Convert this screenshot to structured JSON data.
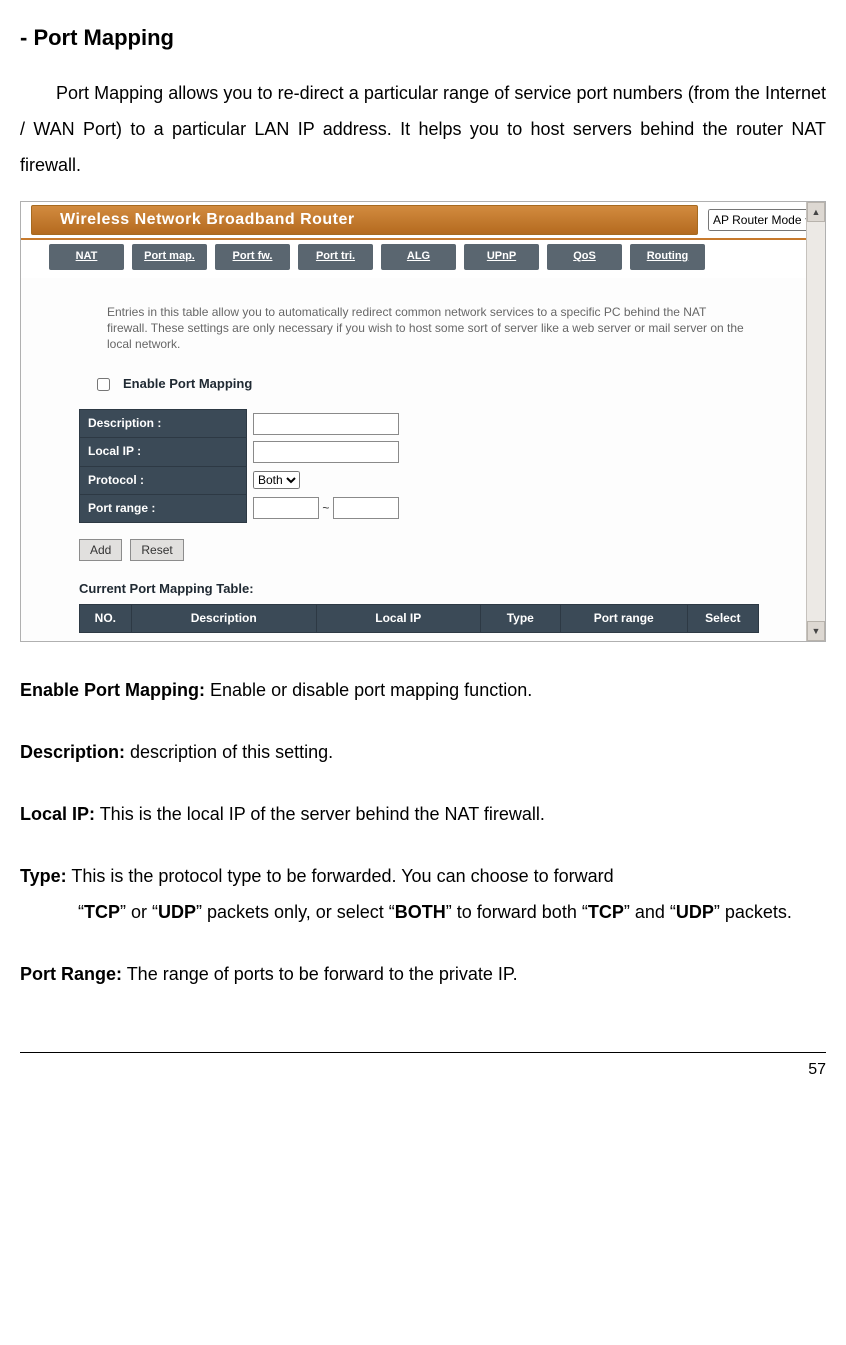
{
  "heading": "- Port Mapping",
  "intro": "Port Mapping allows you to re-direct a particular range of service port numbers (from the Internet / WAN Port) to a particular LAN IP address. It helps you to host servers behind the router NAT firewall.",
  "shot": {
    "brand_title": "Wireless Network Broadband Router",
    "mode_selected": "AP Router Mode",
    "tabs": [
      "NAT",
      "Port map.",
      "Port fw.",
      "Port tri.",
      "ALG",
      "UPnP",
      "QoS",
      "Routing"
    ],
    "help_text": "Entries in this table allow you to automatically redirect common network services to a specific PC behind the NAT firewall. These settings are only necessary if you wish to host some sort of server like a web server or mail server on the local network.",
    "enable_label": "Enable Port Mapping",
    "form": {
      "description_label": "Description :",
      "localip_label": "Local IP :",
      "protocol_label": "Protocol :",
      "protocol_value": "Both",
      "portrange_label": "Port range :",
      "portrange_sep": "~"
    },
    "buttons": {
      "add": "Add",
      "reset": "Reset"
    },
    "table_title": "Current Port Mapping Table:",
    "cols": [
      "NO.",
      "Description",
      "Local IP",
      "Type",
      "Port range",
      "Select"
    ]
  },
  "defs": {
    "enable_term": "Enable Port Mapping:",
    "enable_text": " Enable or disable port mapping function.",
    "desc_term": "Description:",
    "desc_text": " description of this setting.",
    "localip_term": "Local IP:",
    "localip_text": " This is the local IP of the server behind the NAT firewall.",
    "type_term": "Type:",
    "type_line1a": " This is the protocol type to be forwarded. You can choose to forward ",
    "type_line1b": "“",
    "type_tcp": "TCP",
    "type_line1c": "” or “",
    "type_udp": "UDP",
    "type_line1d": "” packets only, or select “",
    "type_both": "BOTH",
    "type_line1e": "” to forward both “",
    "type_tcp2": "TCP",
    "type_line1f": "” and “",
    "type_udp2": "UDP",
    "type_line1g": "” packets.",
    "pr_term": "Port Range:",
    "pr_text": " The range of ports to be forward to the private IP."
  },
  "page_number": "57"
}
